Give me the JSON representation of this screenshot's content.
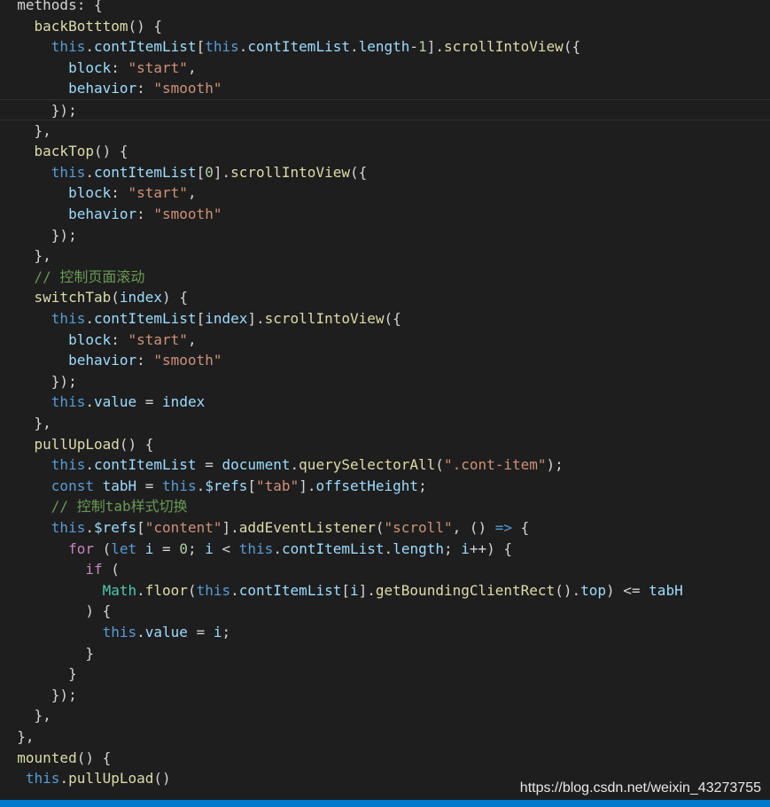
{
  "editor": {
    "lines": [
      [
        [
          "t-pun",
          "  methods: {"
        ]
      ],
      [
        [
          "t-pun",
          "    "
        ],
        [
          "t-fn",
          "backBotttom"
        ],
        [
          "t-pun",
          "() "
        ],
        [
          "t-pun",
          "{"
        ]
      ],
      [
        [
          "t-pun",
          "      "
        ],
        [
          "t-kw",
          "this"
        ],
        [
          "t-pun",
          "."
        ],
        [
          "t-var",
          "contItemList"
        ],
        [
          "t-pun",
          "["
        ],
        [
          "t-kw",
          "this"
        ],
        [
          "t-pun",
          "."
        ],
        [
          "t-var",
          "contItemList"
        ],
        [
          "t-pun",
          "."
        ],
        [
          "t-var",
          "length"
        ],
        [
          "t-pun",
          "-"
        ],
        [
          "t-num",
          "1"
        ],
        [
          "t-pun",
          "]."
        ],
        [
          "t-fn",
          "scrollIntoView"
        ],
        [
          "t-pun",
          "({"
        ]
      ],
      [
        [
          "t-pun",
          "        "
        ],
        [
          "t-var",
          "block"
        ],
        [
          "t-pun",
          ": "
        ],
        [
          "t-str",
          "\"start\""
        ],
        [
          "t-pun",
          ","
        ]
      ],
      [
        [
          "t-pun",
          "        "
        ],
        [
          "t-var",
          "behavior"
        ],
        [
          "t-pun",
          ": "
        ],
        [
          "t-str",
          "\"smooth\""
        ]
      ],
      [
        [
          "t-pun",
          "      });"
        ]
      ],
      [
        [
          "t-pun",
          "    }"
        ],
        [
          "t-pun",
          ","
        ]
      ],
      [
        [
          "t-pun",
          "    "
        ],
        [
          "t-fn",
          "backTop"
        ],
        [
          "t-pun",
          "() {"
        ]
      ],
      [
        [
          "t-pun",
          "      "
        ],
        [
          "t-kw",
          "this"
        ],
        [
          "t-pun",
          "."
        ],
        [
          "t-var",
          "contItemList"
        ],
        [
          "t-pun",
          "["
        ],
        [
          "t-num",
          "0"
        ],
        [
          "t-pun",
          "]."
        ],
        [
          "t-fn",
          "scrollIntoView"
        ],
        [
          "t-pun",
          "({"
        ]
      ],
      [
        [
          "t-pun",
          "        "
        ],
        [
          "t-var",
          "block"
        ],
        [
          "t-pun",
          ": "
        ],
        [
          "t-str",
          "\"start\""
        ],
        [
          "t-pun",
          ","
        ]
      ],
      [
        [
          "t-pun",
          "        "
        ],
        [
          "t-var",
          "behavior"
        ],
        [
          "t-pun",
          ": "
        ],
        [
          "t-str",
          "\"smooth\""
        ]
      ],
      [
        [
          "t-pun",
          "      });"
        ]
      ],
      [
        [
          "t-pun",
          "    },"
        ]
      ],
      [
        [
          "t-pun",
          "    "
        ],
        [
          "t-cmt",
          "// 控制页面滚动"
        ]
      ],
      [
        [
          "t-pun",
          "    "
        ],
        [
          "t-fn",
          "switchTab"
        ],
        [
          "t-pun",
          "("
        ],
        [
          "t-var",
          "index"
        ],
        [
          "t-pun",
          ") {"
        ]
      ],
      [
        [
          "t-pun",
          "      "
        ],
        [
          "t-kw",
          "this"
        ],
        [
          "t-pun",
          "."
        ],
        [
          "t-var",
          "contItemList"
        ],
        [
          "t-pun",
          "["
        ],
        [
          "t-var",
          "index"
        ],
        [
          "t-pun",
          "]."
        ],
        [
          "t-fn",
          "scrollIntoView"
        ],
        [
          "t-pun",
          "({"
        ]
      ],
      [
        [
          "t-pun",
          "        "
        ],
        [
          "t-var",
          "block"
        ],
        [
          "t-pun",
          ": "
        ],
        [
          "t-str",
          "\"start\""
        ],
        [
          "t-pun",
          ","
        ]
      ],
      [
        [
          "t-pun",
          "        "
        ],
        [
          "t-var",
          "behavior"
        ],
        [
          "t-pun",
          ": "
        ],
        [
          "t-str",
          "\"smooth\""
        ]
      ],
      [
        [
          "t-pun",
          "      });"
        ]
      ],
      [
        [
          "t-pun",
          "      "
        ],
        [
          "t-kw",
          "this"
        ],
        [
          "t-pun",
          "."
        ],
        [
          "t-var",
          "value"
        ],
        [
          "t-pun",
          " = "
        ],
        [
          "t-var",
          "index"
        ]
      ],
      [
        [
          "t-pun",
          "    },"
        ]
      ],
      [
        [
          "t-pun",
          "    "
        ],
        [
          "t-fn",
          "pullUpLoad"
        ],
        [
          "t-pun",
          "() {"
        ]
      ],
      [
        [
          "t-pun",
          "      "
        ],
        [
          "t-kw",
          "this"
        ],
        [
          "t-pun",
          "."
        ],
        [
          "t-var",
          "contItemList"
        ],
        [
          "t-pun",
          " = "
        ],
        [
          "t-var",
          "document"
        ],
        [
          "t-pun",
          "."
        ],
        [
          "t-fn",
          "querySelectorAll"
        ],
        [
          "t-pun",
          "("
        ],
        [
          "t-str",
          "\".cont-item\""
        ],
        [
          "t-pun",
          ");"
        ]
      ],
      [
        [
          "t-pun",
          "      "
        ],
        [
          "t-kw",
          "const"
        ],
        [
          "t-pun",
          " "
        ],
        [
          "t-var",
          "tabH"
        ],
        [
          "t-pun",
          " = "
        ],
        [
          "t-kw",
          "this"
        ],
        [
          "t-pun",
          "."
        ],
        [
          "t-var",
          "$refs"
        ],
        [
          "t-pun",
          "["
        ],
        [
          "t-str",
          "\"tab\""
        ],
        [
          "t-pun",
          "]."
        ],
        [
          "t-var",
          "offsetHeight"
        ],
        [
          "t-pun",
          ";"
        ]
      ],
      [
        [
          "t-pun",
          "      "
        ],
        [
          "t-cmt",
          "// 控制tab样式切换"
        ]
      ],
      [
        [
          "t-pun",
          "      "
        ],
        [
          "t-kw",
          "this"
        ],
        [
          "t-pun",
          "."
        ],
        [
          "t-var",
          "$refs"
        ],
        [
          "t-pun",
          "["
        ],
        [
          "t-str",
          "\"content\""
        ],
        [
          "t-pun",
          "]."
        ],
        [
          "t-fn",
          "addEventListener"
        ],
        [
          "t-pun",
          "("
        ],
        [
          "t-str",
          "\"scroll\""
        ],
        [
          "t-pun",
          ", () "
        ],
        [
          "t-kw",
          "=>"
        ],
        [
          "t-pun",
          " {"
        ]
      ],
      [
        [
          "t-pun",
          "        "
        ],
        [
          "t-ctrl",
          "for"
        ],
        [
          "t-pun",
          " ("
        ],
        [
          "t-kw",
          "let"
        ],
        [
          "t-pun",
          " "
        ],
        [
          "t-var",
          "i"
        ],
        [
          "t-pun",
          " = "
        ],
        [
          "t-num",
          "0"
        ],
        [
          "t-pun",
          "; "
        ],
        [
          "t-var",
          "i"
        ],
        [
          "t-pun",
          " < "
        ],
        [
          "t-kw",
          "this"
        ],
        [
          "t-pun",
          "."
        ],
        [
          "t-var",
          "contItemList"
        ],
        [
          "t-pun",
          "."
        ],
        [
          "t-var",
          "length"
        ],
        [
          "t-pun",
          "; "
        ],
        [
          "t-var",
          "i"
        ],
        [
          "t-pun",
          "++) {"
        ]
      ],
      [
        [
          "t-pun",
          "          "
        ],
        [
          "t-ctrl",
          "if"
        ],
        [
          "t-pun",
          " ("
        ]
      ],
      [
        [
          "t-pun",
          "            "
        ],
        [
          "t-cls",
          "Math"
        ],
        [
          "t-pun",
          "."
        ],
        [
          "t-fn",
          "floor"
        ],
        [
          "t-pun",
          "("
        ],
        [
          "t-kw",
          "this"
        ],
        [
          "t-pun",
          "."
        ],
        [
          "t-var",
          "contItemList"
        ],
        [
          "t-pun",
          "["
        ],
        [
          "t-var",
          "i"
        ],
        [
          "t-pun",
          "]."
        ],
        [
          "t-fn",
          "getBoundingClientRect"
        ],
        [
          "t-pun",
          "()."
        ],
        [
          "t-var",
          "top"
        ],
        [
          "t-pun",
          ") <= "
        ],
        [
          "t-var",
          "tabH"
        ]
      ],
      [
        [
          "t-pun",
          "          ) {"
        ]
      ],
      [
        [
          "t-pun",
          "            "
        ],
        [
          "t-kw",
          "this"
        ],
        [
          "t-pun",
          "."
        ],
        [
          "t-var",
          "value"
        ],
        [
          "t-pun",
          " = "
        ],
        [
          "t-var",
          "i"
        ],
        [
          "t-pun",
          ";"
        ]
      ],
      [
        [
          "t-pun",
          "          }"
        ]
      ],
      [
        [
          "t-pun",
          "        }"
        ]
      ],
      [
        [
          "t-pun",
          "      });"
        ]
      ],
      [
        [
          "t-pun",
          "    },"
        ]
      ],
      [
        [
          "t-pun",
          "  },"
        ]
      ],
      [
        [
          "t-pun",
          "  "
        ],
        [
          "t-fn",
          "mounted"
        ],
        [
          "t-pun",
          "() {"
        ]
      ],
      [
        [
          "t-pun",
          "   "
        ],
        [
          "t-kw",
          "this"
        ],
        [
          "t-pun",
          "."
        ],
        [
          "t-fn",
          "pullUpLoad"
        ],
        [
          "t-pun",
          "()"
        ]
      ]
    ]
  },
  "watermark": "https://blog.csdn.net/weixin_43273755",
  "colors": {
    "background": "#1e1e1e",
    "keyword": "#569cd6",
    "function": "#dcdcaa",
    "variable": "#9cdcfe",
    "string": "#ce9178",
    "number": "#b5cea8",
    "comment": "#6a9955",
    "control": "#c586c0",
    "class": "#4ec9b0",
    "statusbar": "#007acc"
  }
}
